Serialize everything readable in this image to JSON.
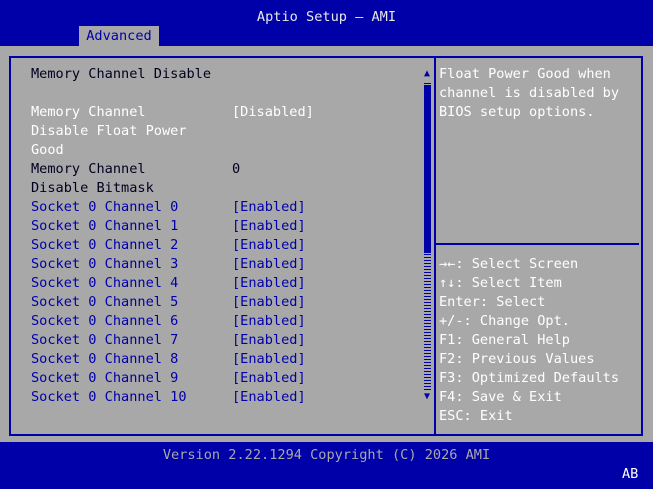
{
  "header": {
    "title": "Aptio Setup – AMI",
    "tabs": [
      {
        "label": "Advanced",
        "active": true
      }
    ]
  },
  "page": {
    "title": "Memory Channel Disable",
    "settings": [
      {
        "label_lines": [
          "Memory Channel",
          "Disable Float Power",
          "Good"
        ],
        "value": "[Disabled]",
        "style": "white"
      },
      {
        "label_lines": [
          "Memory Channel",
          "Disable Bitmask"
        ],
        "value": "0",
        "style": "dark"
      }
    ],
    "channels": [
      {
        "label": "Socket 0 Channel 0",
        "value": "[Enabled]"
      },
      {
        "label": "Socket 0 Channel 1",
        "value": "[Enabled]"
      },
      {
        "label": "Socket 0 Channel 2",
        "value": "[Enabled]"
      },
      {
        "label": "Socket 0 Channel 3",
        "value": "[Enabled]"
      },
      {
        "label": "Socket 0 Channel 4",
        "value": "[Enabled]"
      },
      {
        "label": "Socket 0 Channel 5",
        "value": "[Enabled]"
      },
      {
        "label": "Socket 0 Channel 6",
        "value": "[Enabled]"
      },
      {
        "label": "Socket 0 Channel 7",
        "value": "[Enabled]"
      },
      {
        "label": "Socket 0 Channel 8",
        "value": "[Enabled]"
      },
      {
        "label": "Socket 0 Channel 9",
        "value": "[Enabled]"
      },
      {
        "label": "Socket 0 Channel 10",
        "value": "[Enabled]"
      }
    ]
  },
  "help": {
    "lines": [
      "Float Power Good when",
      "channel is disabled by",
      "BIOS setup options."
    ]
  },
  "keys": [
    "→←: Select Screen",
    "↑↓: Select Item",
    "Enter: Select",
    "+/-: Change Opt.",
    "F1: General Help",
    "F2: Previous Values",
    "F3: Optimized Defaults",
    "F4: Save & Exit",
    "ESC: Exit"
  ],
  "footer": {
    "version": "Version 2.22.1294 Copyright (C) 2026 AMI",
    "badge": "AB"
  },
  "colors": {
    "background": "#0000a8",
    "panel": "#a8a8a8",
    "highlight_text": "#ffffff",
    "static_text": "#000020",
    "option_text": "#0000a8"
  },
  "icons": {
    "scroll_up": "triangle-up-icon",
    "scroll_down": "triangle-down-icon"
  }
}
